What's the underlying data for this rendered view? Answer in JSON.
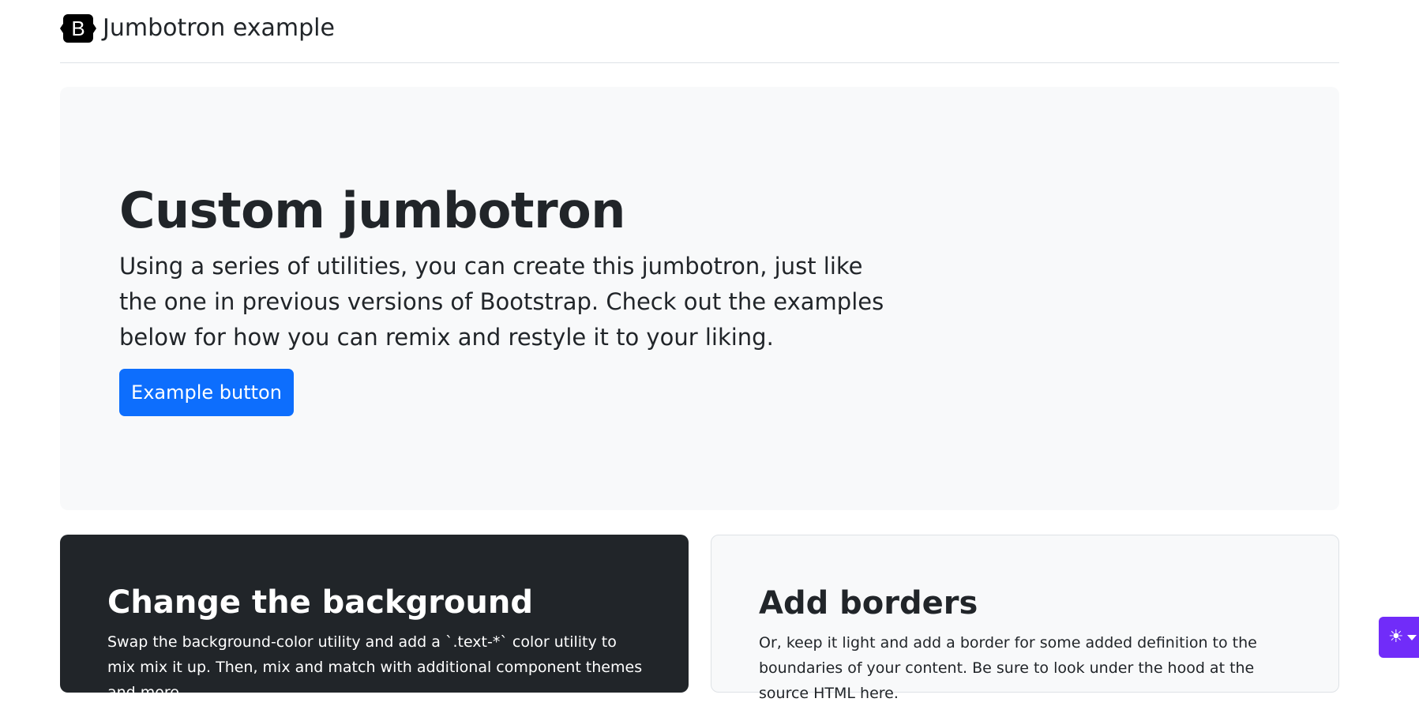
{
  "header": {
    "logo_letter": "B",
    "brand_text": "Jumbotron example"
  },
  "jumbotron": {
    "title": "Custom jumbotron",
    "lead": "Using a series of utilities, you can create this jumbotron, just like the one in previous versions of Bootstrap. Check out the examples below for how you can remix and restyle it to your liking.",
    "button_label": "Example button"
  },
  "cards": [
    {
      "title": "Change the background",
      "text": "Swap the background-color utility and add a `.text-*` color utility to mix mix it up. Then, mix and match with additional component themes and more."
    },
    {
      "title": "Add borders",
      "text": "Or, keep it light and add a border for some added definition to the boundaries of your content. Be sure to look under the hood at the source HTML here."
    }
  ],
  "theme_toggle": {
    "icon": "sun-icon",
    "glyph": "☀"
  },
  "colors": {
    "primary": "#0d6efd",
    "dark": "#212529",
    "light": "#f8f9fa",
    "accent": "#712cf9"
  }
}
